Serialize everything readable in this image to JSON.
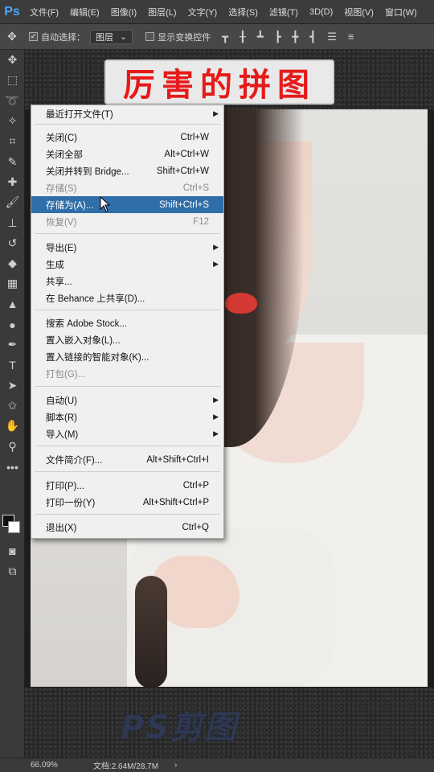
{
  "app": {
    "logo": "Ps"
  },
  "menubar": {
    "items": [
      "文件(F)",
      "编辑(E)",
      "图像(I)",
      "图层(L)",
      "文字(Y)",
      "选择(S)",
      "滤镜(T)",
      "3D(D)",
      "视图(V)",
      "窗口(W)"
    ]
  },
  "options": {
    "auto_select_label": "自动选择：",
    "auto_select_value": "图层",
    "show_transform_label": "显示变换控件"
  },
  "banner": {
    "text": "厉害的拼图"
  },
  "watermark": {
    "text": "PS剪图"
  },
  "menu": {
    "items": [
      {
        "label": "最近打开文件(T)",
        "shortcut": "",
        "submenu": true,
        "disabled": false
      },
      {
        "label": "关闭(C)",
        "shortcut": "Ctrl+W",
        "submenu": false,
        "disabled": false
      },
      {
        "label": "关闭全部",
        "shortcut": "Alt+Ctrl+W",
        "submenu": false,
        "disabled": false
      },
      {
        "label": "关闭并转到 Bridge...",
        "shortcut": "Shift+Ctrl+W",
        "submenu": false,
        "disabled": false
      },
      {
        "label": "存储(S)",
        "shortcut": "Ctrl+S",
        "submenu": false,
        "disabled": true
      },
      {
        "label": "存储为(A)...",
        "shortcut": "Shift+Ctrl+S",
        "submenu": false,
        "disabled": false,
        "highlighted": true
      },
      {
        "label": "恢复(V)",
        "shortcut": "F12",
        "submenu": false,
        "disabled": true
      },
      {
        "label": "导出(E)",
        "shortcut": "",
        "submenu": true,
        "disabled": false
      },
      {
        "label": "生成",
        "shortcut": "",
        "submenu": true,
        "disabled": false
      },
      {
        "label": "共享...",
        "shortcut": "",
        "submenu": false,
        "disabled": false
      },
      {
        "label": "在 Behance 上共享(D)...",
        "shortcut": "",
        "submenu": false,
        "disabled": false
      },
      {
        "label": "搜索 Adobe Stock...",
        "shortcut": "",
        "submenu": false,
        "disabled": false
      },
      {
        "label": "置入嵌入对象(L)...",
        "shortcut": "",
        "submenu": false,
        "disabled": false
      },
      {
        "label": "置入链接的智能对象(K)...",
        "shortcut": "",
        "submenu": false,
        "disabled": false
      },
      {
        "label": "打包(G)...",
        "shortcut": "",
        "submenu": false,
        "disabled": true
      },
      {
        "label": "自动(U)",
        "shortcut": "",
        "submenu": true,
        "disabled": false
      },
      {
        "label": "脚本(R)",
        "shortcut": "",
        "submenu": true,
        "disabled": false
      },
      {
        "label": "导入(M)",
        "shortcut": "",
        "submenu": true,
        "disabled": false
      },
      {
        "label": "文件简介(F)...",
        "shortcut": "Alt+Shift+Ctrl+I",
        "submenu": false,
        "disabled": false
      },
      {
        "label": "打印(P)...",
        "shortcut": "Ctrl+P",
        "submenu": false,
        "disabled": false
      },
      {
        "label": "打印一份(Y)",
        "shortcut": "Alt+Shift+Ctrl+P",
        "submenu": false,
        "disabled": false
      },
      {
        "label": "退出(X)",
        "shortcut": "Ctrl+Q",
        "submenu": false,
        "disabled": false
      }
    ]
  },
  "status": {
    "zoom": "66.09%",
    "doc": "文档:2.64M/28.7M",
    "arrow": "›"
  },
  "colors": {
    "highlight": "#2f6ea8",
    "banner_text": "#e61a1a"
  }
}
